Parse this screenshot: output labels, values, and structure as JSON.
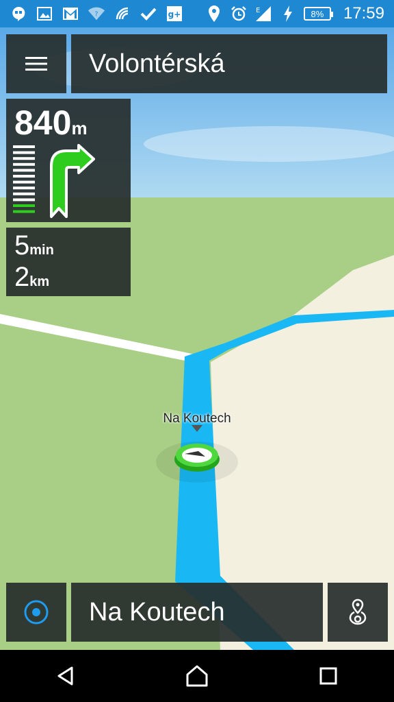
{
  "status_bar": {
    "time": "17:59",
    "battery": "8%",
    "icons": [
      "hangouts-icon",
      "gallery-icon",
      "gmail-icon",
      "wifi-question-icon",
      "nfc-icon",
      "check-icon",
      "google-plus-icon",
      "location-icon",
      "alarm-icon",
      "signal-icon",
      "charging-icon"
    ]
  },
  "header": {
    "menu_icon": "hamburger-menu-icon",
    "street": "Volontérská"
  },
  "maneuver": {
    "distance_value": "840",
    "distance_unit": "m",
    "direction_icon": "turn-right-arrow-icon",
    "progress_bars_total": 12,
    "progress_bars_active": 2,
    "active_color": "#2ecc1f"
  },
  "eta": {
    "time_value": "5",
    "time_unit": "min",
    "distance_value": "2",
    "distance_unit": "km"
  },
  "map": {
    "poi_label": "Na Koutech",
    "route_color": "#19b8f5",
    "grass_color": "#a9cf86",
    "land_color": "#f3f0e0",
    "sky_color": "#7cc0ee"
  },
  "bottom_bar": {
    "locate_icon": "my-location-icon",
    "destination": "Na Koutech",
    "route_icon": "route-pin-icon"
  },
  "nav_bar": {
    "back_icon": "back-icon",
    "home_icon": "home-icon",
    "recents_icon": "recents-icon"
  }
}
